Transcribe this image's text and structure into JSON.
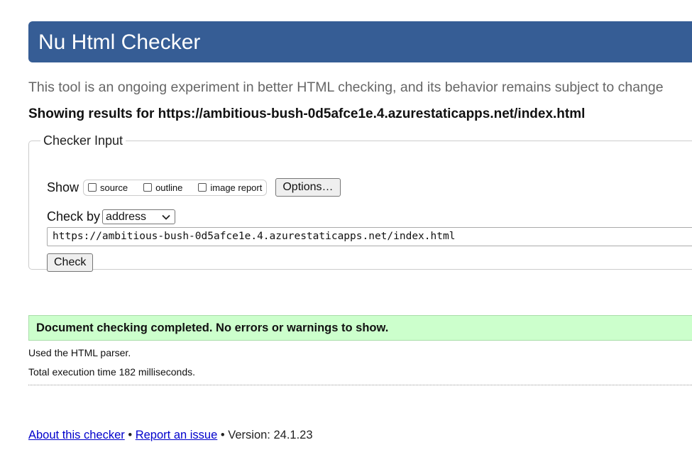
{
  "header": {
    "title": "Nu Html Checker"
  },
  "tagline": "This tool is an ongoing experiment in better HTML checking, and its behavior remains subject to change",
  "results_heading": "Showing results for https://ambitious-bush-0d5afce1e.4.azurestaticapps.net/index.html",
  "checker_input": {
    "legend": "Checker Input",
    "show_label": "Show",
    "options": [
      {
        "label": "source",
        "checked": false
      },
      {
        "label": "outline",
        "checked": false
      },
      {
        "label": "image report",
        "checked": false
      }
    ],
    "options_button": "Options…",
    "check_by_label": "Check by",
    "check_by_selected": "address",
    "url_value": "https://ambitious-bush-0d5afce1e.4.azurestaticapps.net/index.html",
    "check_button": "Check"
  },
  "result": {
    "success_message": "Document checking completed. No errors or warnings to show.",
    "parser_info": "Used the HTML parser.",
    "execution_time": "Total execution time 182 milliseconds."
  },
  "footer": {
    "about_link": "About this checker",
    "separator": "•",
    "report_link": "Report an issue",
    "version_text": "Version: 24.1.23"
  },
  "colors": {
    "banner": "#365d95",
    "success_bg": "#ccffcc",
    "link": "#0000cc"
  }
}
